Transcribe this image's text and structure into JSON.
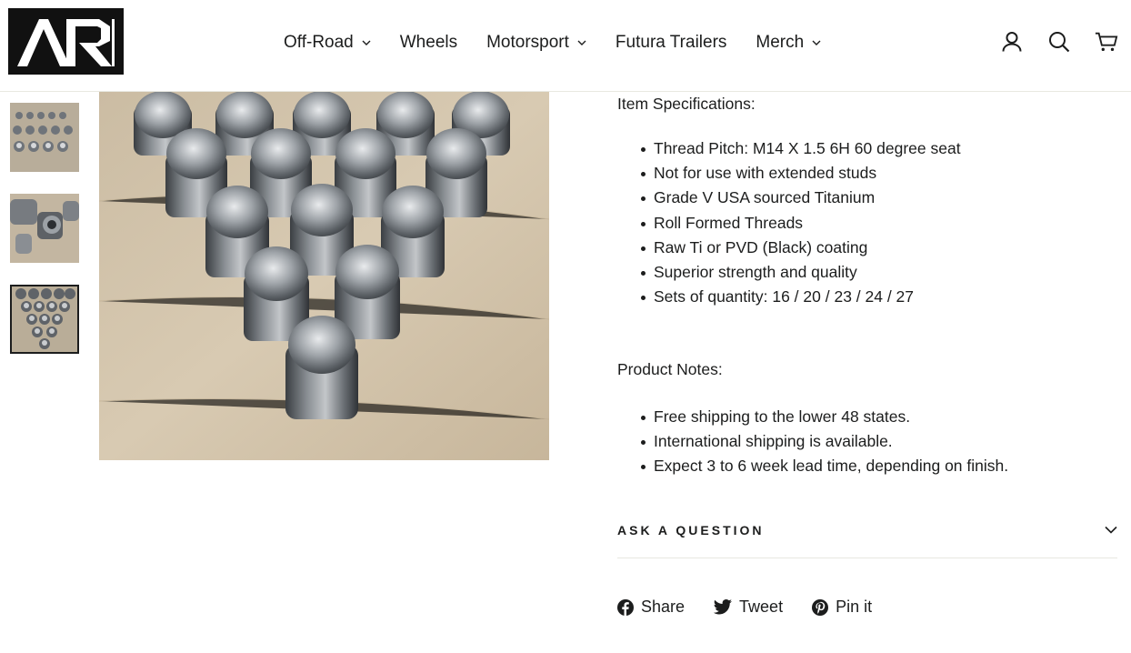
{
  "brand": {
    "logo_text": "AR"
  },
  "nav": {
    "items": [
      {
        "label": "Off-Road",
        "has_dropdown": true
      },
      {
        "label": "Wheels",
        "has_dropdown": false
      },
      {
        "label": "Motorsport",
        "has_dropdown": true
      },
      {
        "label": "Futura Trailers",
        "has_dropdown": false
      },
      {
        "label": "Merch",
        "has_dropdown": true
      }
    ]
  },
  "header_icons": [
    "log-in-icon",
    "search-icon",
    "cart-icon"
  ],
  "gallery": {
    "thumbnails": 3,
    "active_index": 2
  },
  "description": {
    "spec_heading": "Item Specifications:",
    "specs": [
      "Thread Pitch: M14 X 1.5 6H 60 degree seat",
      "Not for use with extended studs",
      "Grade V USA sourced Titanium",
      "Roll Formed Threads",
      "Raw Ti or PVD (Black) coating",
      "Superior strength and quality",
      "Sets of quantity: 16 / 20 / 23 / 24 / 27"
    ],
    "notes_heading": "Product Notes:",
    "notes": [
      "Free shipping to the lower 48 states.",
      "International shipping is available.",
      "Expect 3 to 6 week lead time, depending on finish."
    ]
  },
  "ask_question": {
    "label": "ASK A QUESTION"
  },
  "share": {
    "facebook": "Share",
    "twitter": "Tweet",
    "pinterest": "Pin it"
  },
  "colors": {
    "text": "#1c1d1d",
    "border": "#e8e8e1",
    "logo_bg": "#111111"
  }
}
